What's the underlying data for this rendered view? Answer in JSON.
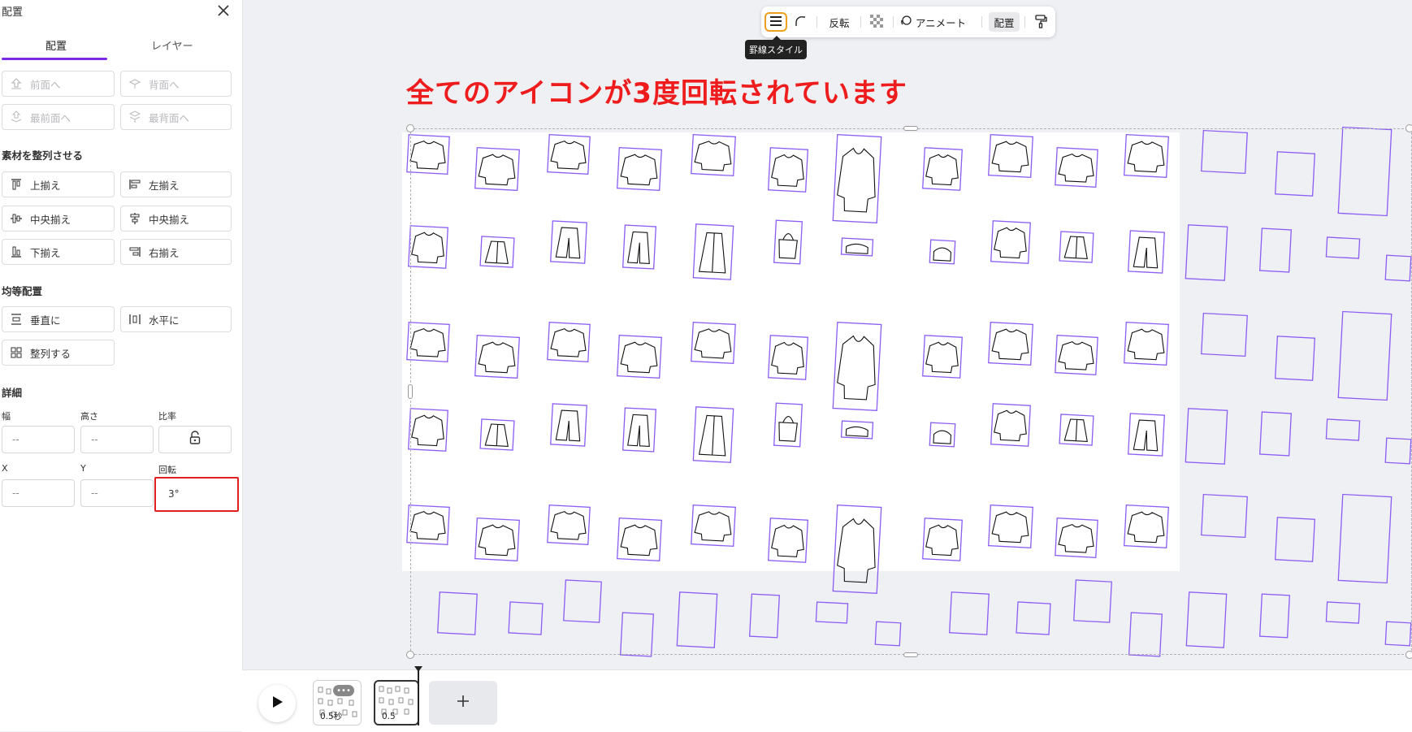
{
  "panel": {
    "title": "配置",
    "tabs": [
      {
        "label": "配置",
        "active": true
      },
      {
        "label": "レイヤー",
        "active": false
      }
    ],
    "order_buttons": [
      {
        "label": "前面へ",
        "icon": "bring-forward-icon"
      },
      {
        "label": "背面へ",
        "icon": "send-backward-icon"
      },
      {
        "label": "最前面へ",
        "icon": "bring-to-front-icon"
      },
      {
        "label": "最背面へ",
        "icon": "send-to-back-icon"
      }
    ],
    "align_title": "素材を整列させる",
    "align_buttons": [
      {
        "label": "上揃え",
        "icon": "align-top-icon"
      },
      {
        "label": "左揃え",
        "icon": "align-left-icon"
      },
      {
        "label": "中央揃え",
        "icon": "align-middle-icon"
      },
      {
        "label": "中央揃え",
        "icon": "align-center-icon"
      },
      {
        "label": "下揃え",
        "icon": "align-bottom-icon"
      },
      {
        "label": "右揃え",
        "icon": "align-right-icon"
      }
    ],
    "spacing_title": "均等配置",
    "spacing_buttons": [
      {
        "label": "垂直に",
        "icon": "distribute-vertical-icon"
      },
      {
        "label": "水平に",
        "icon": "distribute-horizontal-icon"
      },
      {
        "label": "整列する",
        "icon": "tidy-up-icon"
      }
    ],
    "details_title": "詳細",
    "fields": {
      "width": {
        "label": "幅",
        "value": "--"
      },
      "height": {
        "label": "高さ",
        "value": "--"
      },
      "ratio": {
        "label": "比率"
      },
      "x": {
        "label": "X",
        "value": "--"
      },
      "y": {
        "label": "Y",
        "value": "--"
      },
      "rotation": {
        "label": "回転",
        "value": "3°"
      }
    }
  },
  "toolbar": {
    "items": [
      {
        "name": "border-style",
        "icon": "border-style-icon"
      },
      {
        "name": "corner-rounding",
        "icon": "corner-rounding-icon"
      },
      {
        "name": "flip",
        "label": "反転"
      },
      {
        "name": "transparency",
        "icon": "transparency-icon"
      },
      {
        "name": "animate",
        "label": "アニメート",
        "icon": "animate-icon"
      },
      {
        "name": "position",
        "label": "配置"
      },
      {
        "name": "copy-style",
        "icon": "paint-roller-icon"
      }
    ],
    "tooltip": "罫線スタイル"
  },
  "canvas": {
    "heading": "全てのアイコンが3度回転されています",
    "heading_color": "#ee1c1c",
    "accent_color": "#8b5cf6"
  },
  "timeline": {
    "pages": [
      {
        "label": "0.5秒"
      },
      {
        "label": "0.5"
      }
    ],
    "more_label": "•••"
  }
}
